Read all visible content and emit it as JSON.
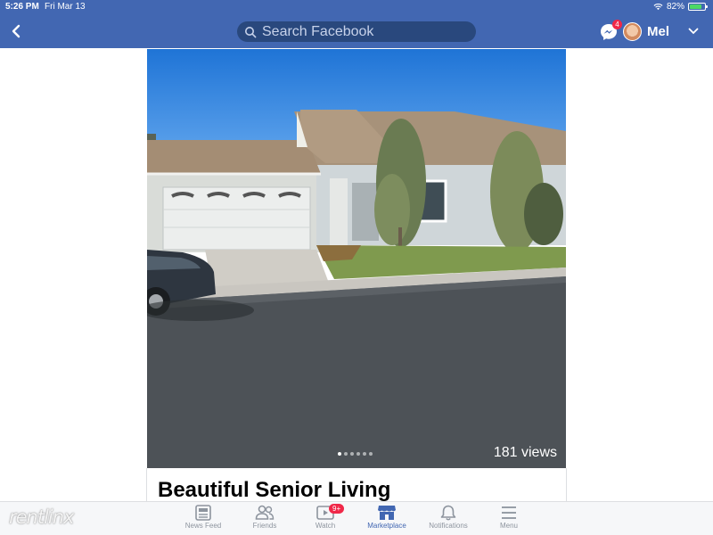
{
  "status": {
    "time": "5:26 PM",
    "date": "Fri Mar 13",
    "battery": "82%",
    "battery_level": 0.82
  },
  "header": {
    "search_placeholder": "Search Facebook",
    "messenger_badge": "4",
    "user_name": "Mel"
  },
  "post": {
    "views": "181 views",
    "title": "Beautiful Senior Living",
    "photo_count": 6,
    "active_photo": 1
  },
  "tabs": [
    {
      "label": "News Feed",
      "icon": "news-feed-icon"
    },
    {
      "label": "Friends",
      "icon": "friends-icon"
    },
    {
      "label": "Watch",
      "icon": "watch-icon",
      "badge": "9+"
    },
    {
      "label": "Marketplace",
      "icon": "marketplace-icon",
      "active": true
    },
    {
      "label": "Notifications",
      "icon": "bell-icon"
    },
    {
      "label": "Menu",
      "icon": "menu-icon"
    }
  ],
  "watermark": "rentlinx",
  "colors": {
    "brand": "#4267b2",
    "search_bg": "#29487d",
    "badge": "#f02849",
    "tab_inactive": "#8d949e"
  }
}
